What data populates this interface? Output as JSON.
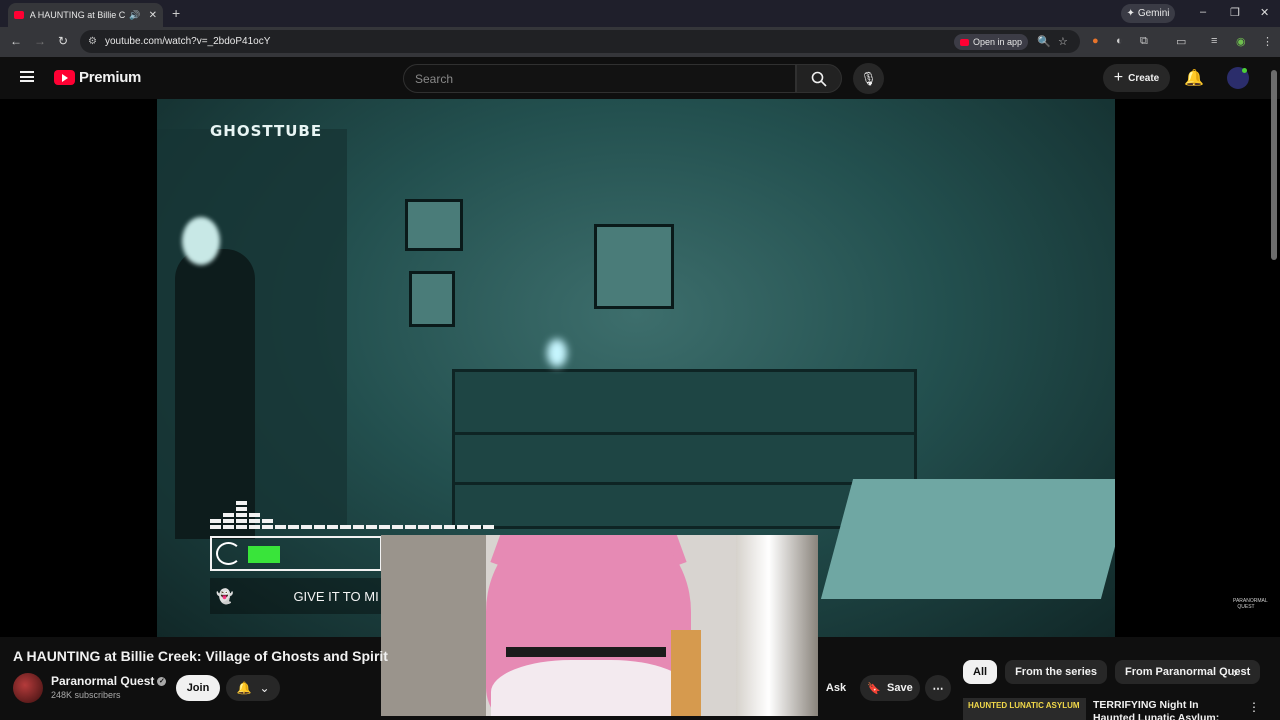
{
  "browser": {
    "tab_title": "A HAUNTING at Billie Creek",
    "new_tab": "+",
    "gemini_label": "Gemini",
    "window_controls": [
      "–",
      "❐",
      "✕"
    ],
    "url": "youtube.com/watch?v=_2bdoP41ocY",
    "open_in_app": "Open in app"
  },
  "youtube": {
    "logo_text": "Premium",
    "search_placeholder": "Search",
    "create_label": "Create"
  },
  "video": {
    "overlay_brand": "GHOSTTUBE",
    "overlay_prompt": "GIVE IT TO MI",
    "watermark": "PARANORMAL QUEST",
    "level_bars": [
      2,
      3,
      5,
      3,
      2,
      1,
      1,
      1,
      1,
      1,
      1,
      1,
      1,
      1,
      1,
      1,
      1,
      1,
      1,
      1,
      1,
      1
    ],
    "meter_fill": 0.2
  },
  "details": {
    "title": "A HAUNTING at Billie Creek: Village of Ghosts and Spirit",
    "channel_name": "Paranormal Quest",
    "subscribers": "248K subscribers",
    "join_label": "Join",
    "ask_label": "Ask",
    "save_label": "Save"
  },
  "sidebar": {
    "chips": [
      "All",
      "From the series",
      "From Paranormal Quest"
    ],
    "rec_thumb_label": "HAUNTED LUNATIC ASYLUM",
    "rec_title": "TERRIFYING Night In Haunted Lunatic Asylum: Paranormal"
  },
  "colors": {
    "yt_red": "#ff0033",
    "meter_green": "#39e43a",
    "background": "#0f0f0f"
  }
}
